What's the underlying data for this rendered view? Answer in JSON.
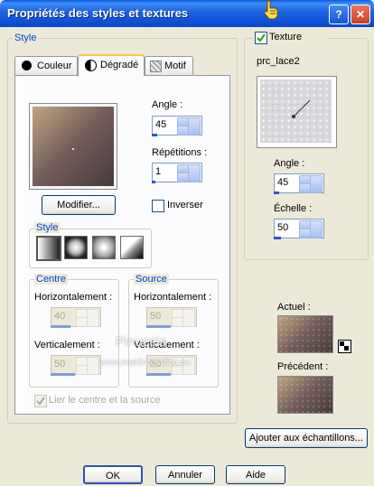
{
  "window": {
    "title": "Propriétés des styles et textures"
  },
  "style_group": {
    "label": "Style"
  },
  "tabs": [
    {
      "label": "Couleur",
      "active": false
    },
    {
      "label": "Dégradé",
      "active": true
    },
    {
      "label": "Motif",
      "active": false
    }
  ],
  "gradient": {
    "colors": [
      "#c0a580",
      "#715c5a",
      "#4a3a3c"
    ],
    "modify_button": "Modifier...",
    "angle": {
      "label": "Angle :",
      "value": "45"
    },
    "repetitions": {
      "label": "Répétitions :",
      "value": "1"
    },
    "invert": {
      "label": "Inverser",
      "checked": false
    },
    "style_label": "Style",
    "styles": [
      "linear",
      "rectangular",
      "sunburst",
      "radial"
    ],
    "centre": {
      "label": "Centre",
      "horizontal": {
        "label": "Horizontalement :",
        "value": "40"
      },
      "vertical": {
        "label": "Verticalement :",
        "value": "50"
      }
    },
    "source": {
      "label": "Source",
      "horizontal": {
        "label": "Horizontalement :",
        "value": "50"
      },
      "vertical": {
        "label": "Verticalement :",
        "value": "50"
      }
    },
    "link": {
      "label": "Lier le centre et la source",
      "checked": true
    }
  },
  "texture": {
    "label": "Texture",
    "checked": true,
    "name": "prc_lace2",
    "angle": {
      "label": "Angle :",
      "value": "45"
    },
    "scale": {
      "label": "Échelle :",
      "value": "50"
    }
  },
  "current": {
    "label": "Actuel :"
  },
  "previous": {
    "label": "Précédent :"
  },
  "add_swatch_button": "Ajouter aux échantillons...",
  "buttons": {
    "ok": "OK",
    "cancel": "Annuler",
    "help": "Aide"
  },
  "titlebar_buttons": {
    "help": "?",
    "close": "✕"
  },
  "watermark": {
    "line1": "Pinuccia",
    "line2": "www.maidiregrafica.eu"
  }
}
